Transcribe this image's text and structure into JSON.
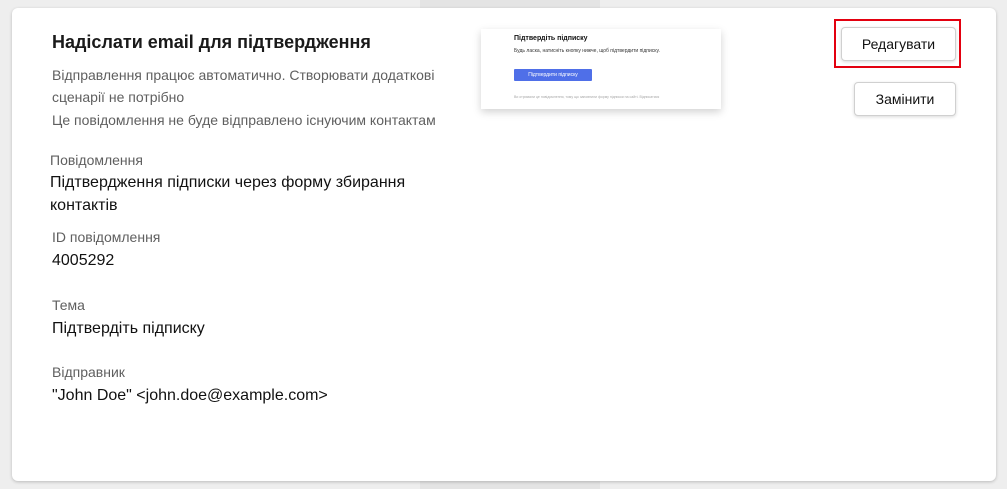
{
  "card": {
    "title": "Надіслати email для підтвердження",
    "info_auto": "Відправлення працює автоматично. Створювати додаткові сценарії не потрібно",
    "info_existing": "Це повідомлення не буде відправлено існуючим контактам"
  },
  "fields": {
    "message_label": "Повідомлення",
    "message_value": "Підтвердження підписки через форму збирання контактів",
    "id_label": "ID повідомлення",
    "id_value": "4005292",
    "subject_label": "Тема",
    "subject_value": "Підтвердіть підписку",
    "sender_label": "Відправник",
    "sender_value": "\"John Doe\" <john.doe@example.com>"
  },
  "preview": {
    "title": "Підтвердіть підписку",
    "text": "Будь ласка, натисніть кнопку нижче, щоб підтвердити підписку.",
    "button_label": "Підтвердити підписку",
    "footer": "Ви отримали це повідомлення, тому що заповнили форму підписки на сайті. Відписатися",
    "button_color": "#4f6fe8"
  },
  "actions": {
    "edit_label": "Редагувати",
    "replace_label": "Замінити",
    "highlight_color": "#e3000f"
  }
}
